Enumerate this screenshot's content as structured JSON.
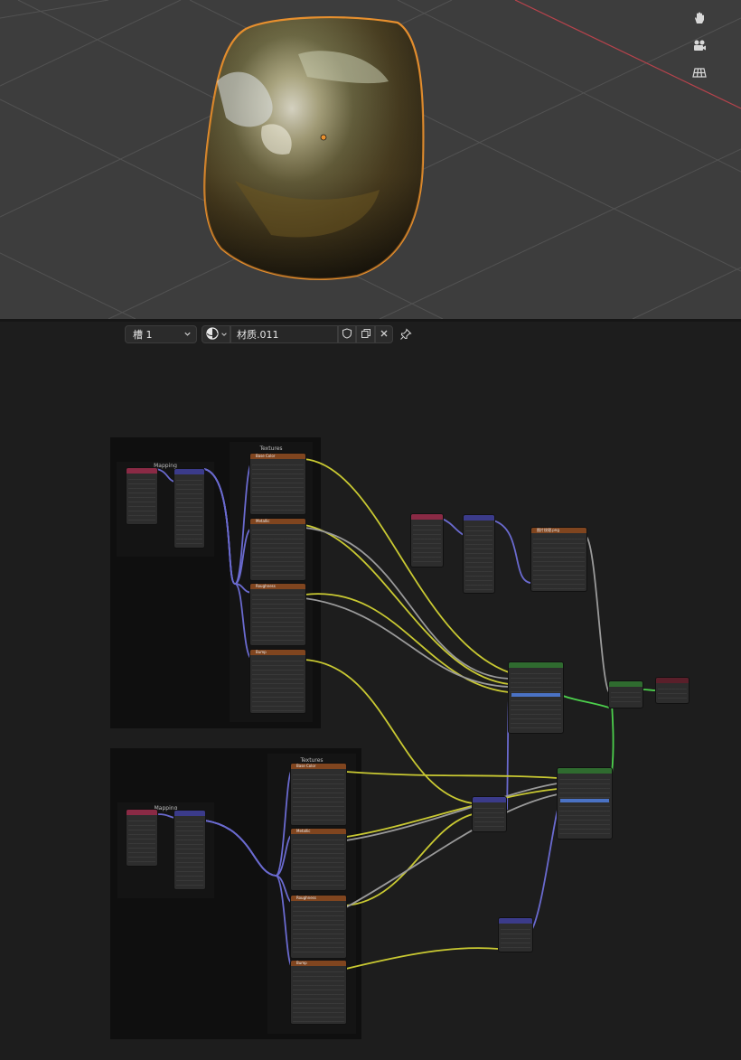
{
  "viewport": {
    "gizmo_icons": [
      "hand-pan-icon",
      "camera-icon",
      "grid-view-icon"
    ]
  },
  "header": {
    "slot_label": "槽 1",
    "material_name": "材质.011",
    "icons": [
      "sphere-material-icon",
      "shield-fake-user-icon",
      "duplicate-icon",
      "close-icon",
      "pin-icon"
    ]
  },
  "frames": {
    "mapping_top": "Mapping",
    "textures_top": "Textures",
    "mapping_bottom": "Mapping",
    "textures_bottom": "Textures"
  },
  "nodes": {
    "tex_base_color": "Base Color",
    "tex_metallic": "Metallic",
    "tex_roughness": "Roughness",
    "tex_bump": "Bump",
    "tex_png": "图片纹理.png"
  },
  "colors": {
    "viewport_bg": "#3d3d3d",
    "selection_outline": "#e8902e",
    "axis_x": "#c0404a",
    "editor_bg": "#1d1d1d",
    "texture_header": "#80451f",
    "vector_header": "#3b3b8a",
    "input_header": "#8a2a45",
    "shader_header": "#2f6b2f",
    "output_header": "#5a1f2a",
    "link_yellow": "#c9c932",
    "link_gray": "#9a9a9a",
    "link_blue": "#6a6acf",
    "link_green": "#4ccf4c"
  }
}
